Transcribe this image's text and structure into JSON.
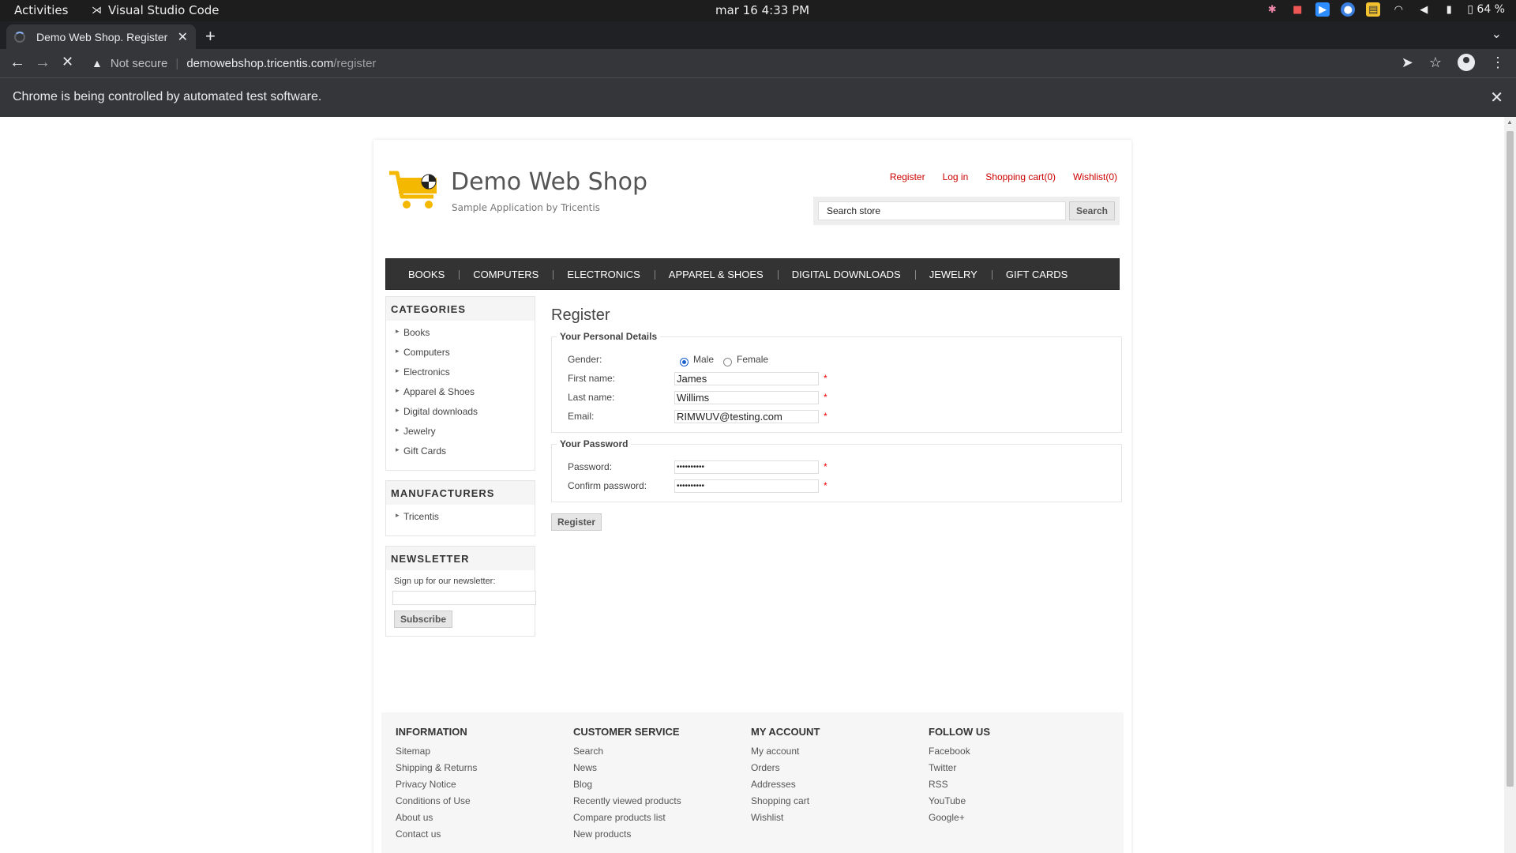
{
  "system_bar": {
    "activities": "Activities",
    "app_name": "Visual Studio Code",
    "clock": "mar 16  4:33 PM",
    "battery": "64 %"
  },
  "browser": {
    "tab_title": "Demo Web Shop. Register",
    "security_label": "Not secure",
    "url_host": "demowebshop.tricentis.com",
    "url_path": "/register",
    "infobar_message": "Chrome is being controlled by automated test software."
  },
  "site": {
    "brand": "Demo Web Shop",
    "tagline": "Sample Application by Tricentis",
    "header_links": [
      "Register",
      "Log in",
      "Shopping cart(0)",
      "Wishlist(0)"
    ],
    "search_value": "Search store",
    "search_button": "Search",
    "top_menu": [
      "BOOKS",
      "COMPUTERS",
      "ELECTRONICS",
      "APPAREL & SHOES",
      "DIGITAL DOWNLOADS",
      "JEWELRY",
      "GIFT CARDS"
    ],
    "categories_title": "CATEGORIES",
    "categories": [
      "Books",
      "Computers",
      "Electronics",
      "Apparel & Shoes",
      "Digital downloads",
      "Jewelry",
      "Gift Cards"
    ],
    "manufacturers_title": "MANUFACTURERS",
    "manufacturers": [
      "Tricentis"
    ],
    "newsletter_title": "NEWSLETTER",
    "newsletter_label": "Sign up for our newsletter:",
    "subscribe_button": "Subscribe"
  },
  "form": {
    "title": "Register",
    "personal_legend": "Your Personal Details",
    "gender_label": "Gender:",
    "gender_male": "Male",
    "gender_female": "Female",
    "gender_selected": "Male",
    "first_name_label": "First name:",
    "first_name": "James",
    "last_name_label": "Last name:",
    "last_name": "Willims",
    "email_label": "Email:",
    "email": "RIMWUV@testing.com",
    "password_legend": "Your Password",
    "password_label": "Password:",
    "password_mask": "••••••••••",
    "confirm_label": "Confirm password:",
    "confirm_mask": "••••••••••",
    "required_mark": "*",
    "register_button": "Register"
  },
  "footer": {
    "columns": [
      {
        "title": "INFORMATION",
        "links": [
          "Sitemap",
          "Shipping & Returns",
          "Privacy Notice",
          "Conditions of Use",
          "About us",
          "Contact us"
        ]
      },
      {
        "title": "CUSTOMER SERVICE",
        "links": [
          "Search",
          "News",
          "Blog",
          "Recently viewed products",
          "Compare products list",
          "New products"
        ]
      },
      {
        "title": "MY ACCOUNT",
        "links": [
          "My account",
          "Orders",
          "Addresses",
          "Shopping cart",
          "Wishlist"
        ]
      },
      {
        "title": "FOLLOW US",
        "links": [
          "Facebook",
          "Twitter",
          "RSS",
          "YouTube",
          "Google+"
        ]
      }
    ]
  },
  "colors": {
    "link_red": "#cc0000",
    "menu_bg": "#333333",
    "cart_yellow": "#f5b800"
  }
}
